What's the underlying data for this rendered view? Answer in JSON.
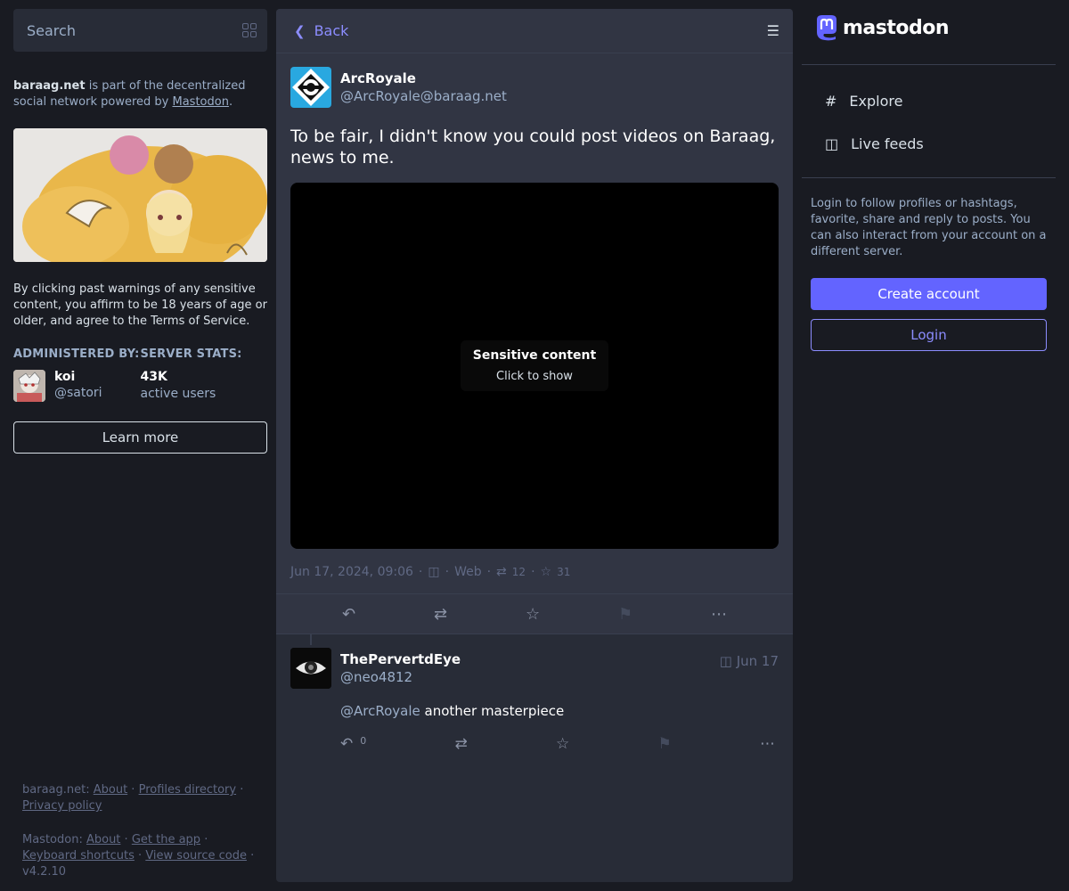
{
  "search": {
    "placeholder": "Search",
    "icon": "grid-icon"
  },
  "about": {
    "domain": "baraag.net",
    "text_middle": " is part of the decentralized social network powered by ",
    "mastodon_link": "Mastodon",
    "period": "."
  },
  "disclaimer": "By clicking past warnings of any sensitive content, you affirm to be 18 years of age or older, and agree to the Terms of Service.",
  "admin": {
    "heading": "ADMINISTERED BY:",
    "name": "koi",
    "handle": "@satori"
  },
  "server_stats": {
    "heading": "SERVER STATS:",
    "value": "43K",
    "label": "active users"
  },
  "learn_more": "Learn more",
  "footer": {
    "server_label": "baraag.net",
    "server_links": [
      "About",
      "Profiles directory",
      "Privacy policy"
    ],
    "mastodon_label": "Mastodon",
    "mastodon_links": [
      "About",
      "Get the app",
      "Keyboard shortcuts",
      "View source code"
    ],
    "version": "v4.2.10"
  },
  "header": {
    "back_label": "Back",
    "back_icon": "chevron-left-icon",
    "settings_icon": "sliders-icon"
  },
  "status": {
    "display_name": "ArcRoyale",
    "handle": "@ArcRoyale@baraag.net",
    "text": "To be fair, I didn't know you could post videos on Baraag, news to me.",
    "spoiler_title": "Sensitive content",
    "spoiler_sub": "Click to show",
    "date": "Jun 17, 2024, 09:06",
    "visibility_icon": "globe-icon",
    "application": "Web",
    "boosts": "12",
    "favourites": "31"
  },
  "reply": {
    "display_name": "ThePervertdEye",
    "handle": "@neo4812",
    "time": "Jun 17",
    "mention": "@ArcRoyale",
    "text": " another masterpiece",
    "reply_count": "0"
  },
  "brand": {
    "name": "mastodon",
    "accent": "#6364ff"
  },
  "nav": {
    "explore": "Explore",
    "live_feeds": "Live feeds"
  },
  "login_prompt": "Login to follow profiles or hashtags, favorite, share and reply to posts. You can also interact from your account on a different server.",
  "create_account": "Create account",
  "login": "Login"
}
